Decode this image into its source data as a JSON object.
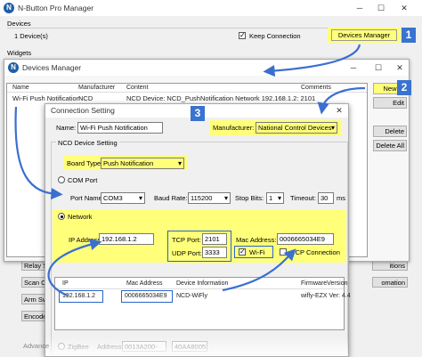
{
  "main_window": {
    "title": "N-Button Pro Manager",
    "devices_label": "Devices",
    "device_count": "1 Device(s)",
    "keep_connection_label": "Keep Connection",
    "devices_manager_button": "Devices Manager",
    "widgets_label": "Widgets",
    "left_buttons": [
      "Relay S",
      "Scan Ch",
      "Arm Swi",
      "Encoder"
    ],
    "right_buttons": [
      "itions",
      "omation"
    ]
  },
  "devices_manager": {
    "title": "Devices Manager",
    "columns": [
      "Name",
      "Manufacturer",
      "Content",
      "Comments"
    ],
    "rows": [
      {
        "name": "Wi-Fi Push Notification",
        "manufacturer": "NCD",
        "content": "NCD Device: NCD_PushNotification  Network  192.168.1.2: 2101",
        "comments": ""
      }
    ],
    "buttons": {
      "new": "New",
      "edit": "Edit",
      "delete": "Delete",
      "delete_all": "Delete All"
    }
  },
  "connection_setting": {
    "title": "Connection Setting",
    "name_label": "Name:",
    "name_value": "Wi-Fi Push Notification",
    "manufacturer_label": "Manufacturer:",
    "manufacturer_value": "National Control Devices",
    "group_title": "NCD Device Setting",
    "board_type_label": "Board Type:",
    "board_type_value": "Push Notification",
    "com_port_label": "COM Port",
    "port_name_label": "Port Name:",
    "port_name_value": "COM3",
    "baud_rate_label": "Baud Rate:",
    "baud_rate_value": "115200",
    "stop_bits_label": "Stop Bits:",
    "stop_bits_value": "1",
    "timeout_label": "Timeout:",
    "timeout_value": "30",
    "timeout_unit": "ms",
    "network_label": "Network",
    "ip_label": "IP Address:",
    "ip_value": "192.168.1.2",
    "tcp_port_label": "TCP Port:",
    "tcp_port_value": "2101",
    "udp_port_label": "UDP Port:",
    "udp_port_value": "3333",
    "mac_label": "Mac Address:",
    "mac_value": "0006665034E9",
    "wifi_label": "Wi-Fi",
    "tcp_connection_label": "TCP Connection",
    "table_columns": [
      "IP",
      "Mac Address",
      "Device Information",
      "FirmwareVersion"
    ],
    "table_rows": [
      {
        "ip": "192.168.1.2",
        "mac": "0006665034E9",
        "info": "NCD-WiFly",
        "firmware": "wifly-EZX Ver: 4.4"
      }
    ],
    "zigbee_label": "ZigBee",
    "address_label": "Address:",
    "address_value": "0013A200-",
    "address_value2": "40AA8005",
    "advanced_label": "Advance"
  },
  "badges": [
    "1",
    "2",
    "3"
  ],
  "colors": {
    "highlight": "#ffff7a",
    "callout_blue": "#2a64c8",
    "badge": "#3a72d0"
  }
}
